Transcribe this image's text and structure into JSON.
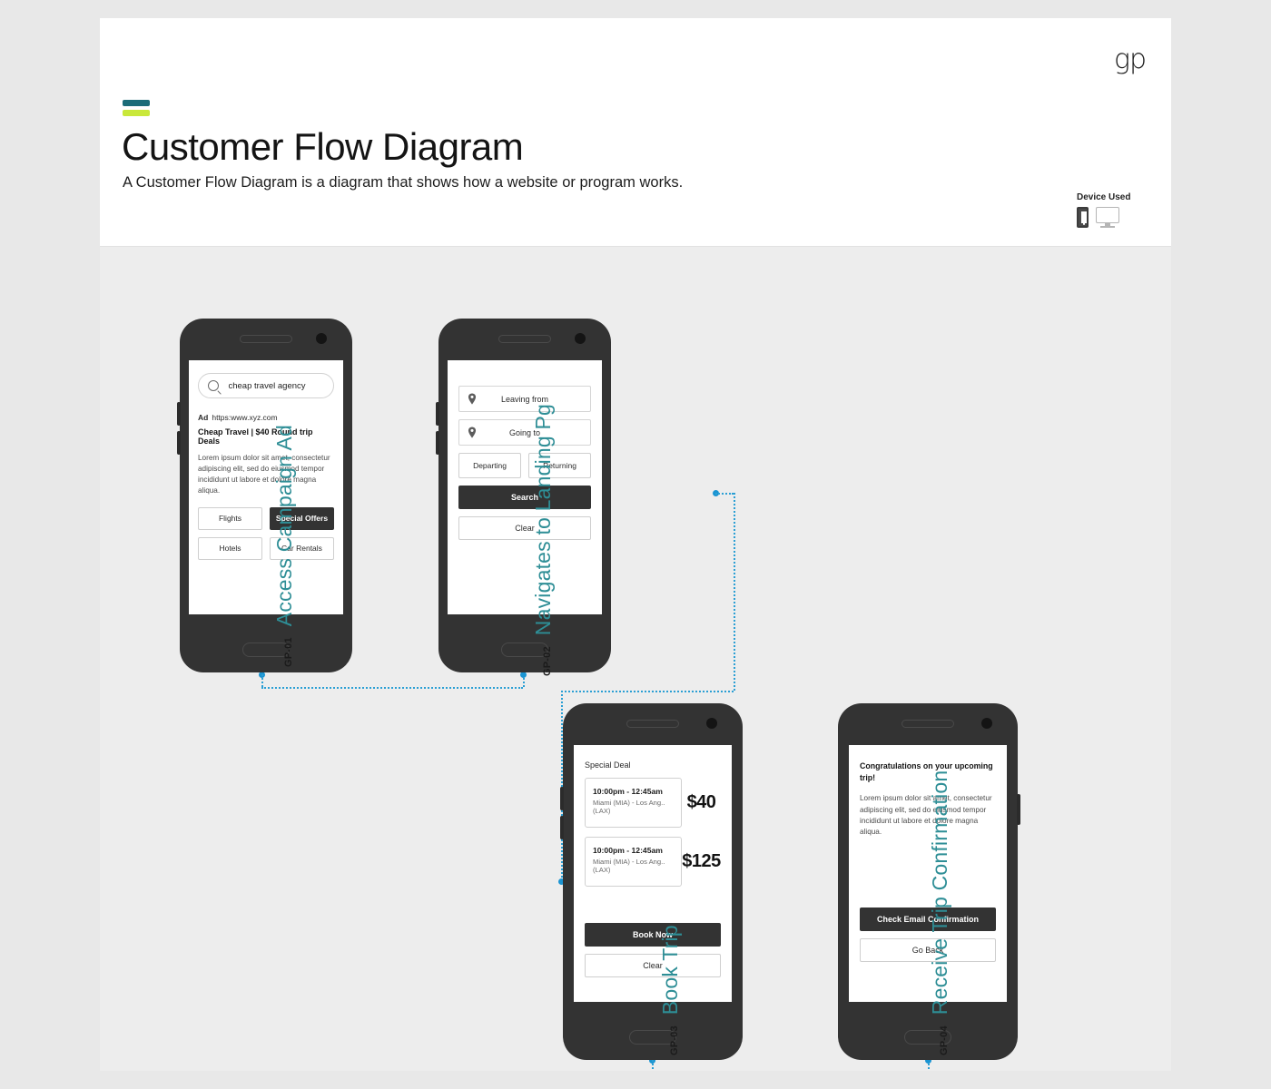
{
  "header": {
    "logo": "gp",
    "title": "Customer Flow Diagram",
    "subtitle": "A Customer Flow Diagram is a diagram that shows how a website or program works.",
    "device_used_label": "Device Used",
    "device_icons": [
      "phone-icon",
      "monitor-icon"
    ],
    "accent_colors": {
      "teal": "#1b6c78",
      "lime": "#c9e83a"
    }
  },
  "theme": {
    "accent_teal": "#2e8e96",
    "connector_blue": "#2b9fd4",
    "frame_dark": "#333333",
    "canvas_bg": "#ededed"
  },
  "steps": [
    {
      "code": "GP-01",
      "name": "Access Campaign Ad"
    },
    {
      "code": "GP-02",
      "name": "Navigates to Landing Pg"
    },
    {
      "code": "GP-03",
      "name": "Book Trip"
    },
    {
      "code": "GP-04",
      "name": "Receive Trip Confirmation"
    }
  ],
  "screen1": {
    "search_value": "cheap travel agency",
    "search_icon": "search-icon",
    "ad_tag": "Ad",
    "ad_url": "https:www.xyz.com",
    "ad_headline": "Cheap Travel | $40 Round trip Deals",
    "ad_body": "Lorem ipsum dolor sit amet, consectetur adipiscing elit, sed do eiusmod tempor incididunt ut labore et dolore magna aliqua.",
    "buttons": [
      {
        "label": "Flights",
        "variant": "light"
      },
      {
        "label": "Special Offers",
        "variant": "dark"
      },
      {
        "label": "Hotels",
        "variant": "light"
      },
      {
        "label": "Car Rentals",
        "variant": "light"
      }
    ]
  },
  "screen2": {
    "fields": [
      {
        "label": "Leaving from",
        "icon": "location-pin-icon"
      },
      {
        "label": "Going to",
        "icon": "location-pin-icon"
      }
    ],
    "date_buttons": [
      {
        "label": "Departing"
      },
      {
        "label": "Returning"
      }
    ],
    "primary_button": "Search",
    "secondary_button": "Clear"
  },
  "screen3": {
    "section_title": "Special Deal",
    "deals": [
      {
        "time": "10:00pm - 12:45am",
        "route": "Miami (MIA) - Los Ang..(LAX)",
        "price": "$40"
      },
      {
        "time": "10:00pm - 12:45am",
        "route": "Miami (MIA) - Los Ang..(LAX)",
        "price": "$125"
      }
    ],
    "primary_button": "Book Now",
    "secondary_button": "Clear"
  },
  "screen4": {
    "title": "Congratulations on your upcoming trip!",
    "body": "Lorem ipsum dolor sit amet, consectetur adipiscing elit, sed do eiusmod tempor incididunt ut labore et dolore magna aliqua.",
    "primary_button": "Check Email Confirmation",
    "secondary_button": "Go Back"
  }
}
